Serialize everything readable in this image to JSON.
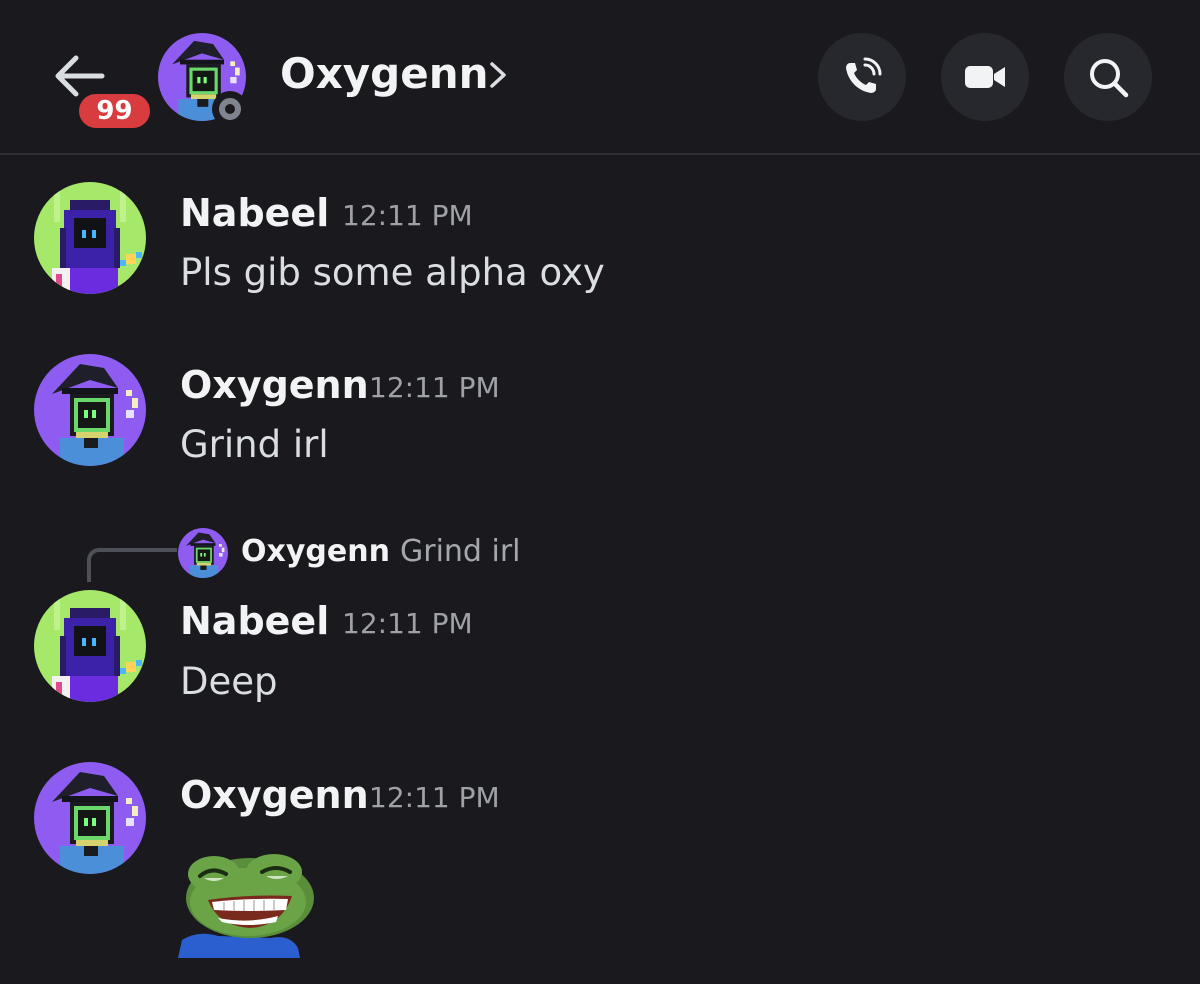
{
  "header": {
    "unread_badge": "99",
    "contact_name": "Oxygenn",
    "contact_status": "offline"
  },
  "messages": [
    {
      "author": "Nabeel",
      "time": "12:11 PM",
      "text": "Pls gib some alpha oxy"
    },
    {
      "author": "Oxygenn",
      "time": "12:11 PM",
      "text": "Grind irl"
    },
    {
      "author": "Nabeel",
      "time": "12:11 PM",
      "text": "Deep",
      "reply_to": {
        "author": "Oxygenn",
        "text": "Grind irl"
      }
    },
    {
      "author": "Oxygenn",
      "time": "12:11 PM",
      "emoji": "pepe-laughing-emoji"
    }
  ],
  "colors": {
    "background": "#1a1a1e",
    "badge": "#d83c3e",
    "button_bg": "#27282d",
    "nabeel_avatar_bg": "#a6e86a",
    "oxygenn_avatar_bg": "#8e5cf0"
  }
}
